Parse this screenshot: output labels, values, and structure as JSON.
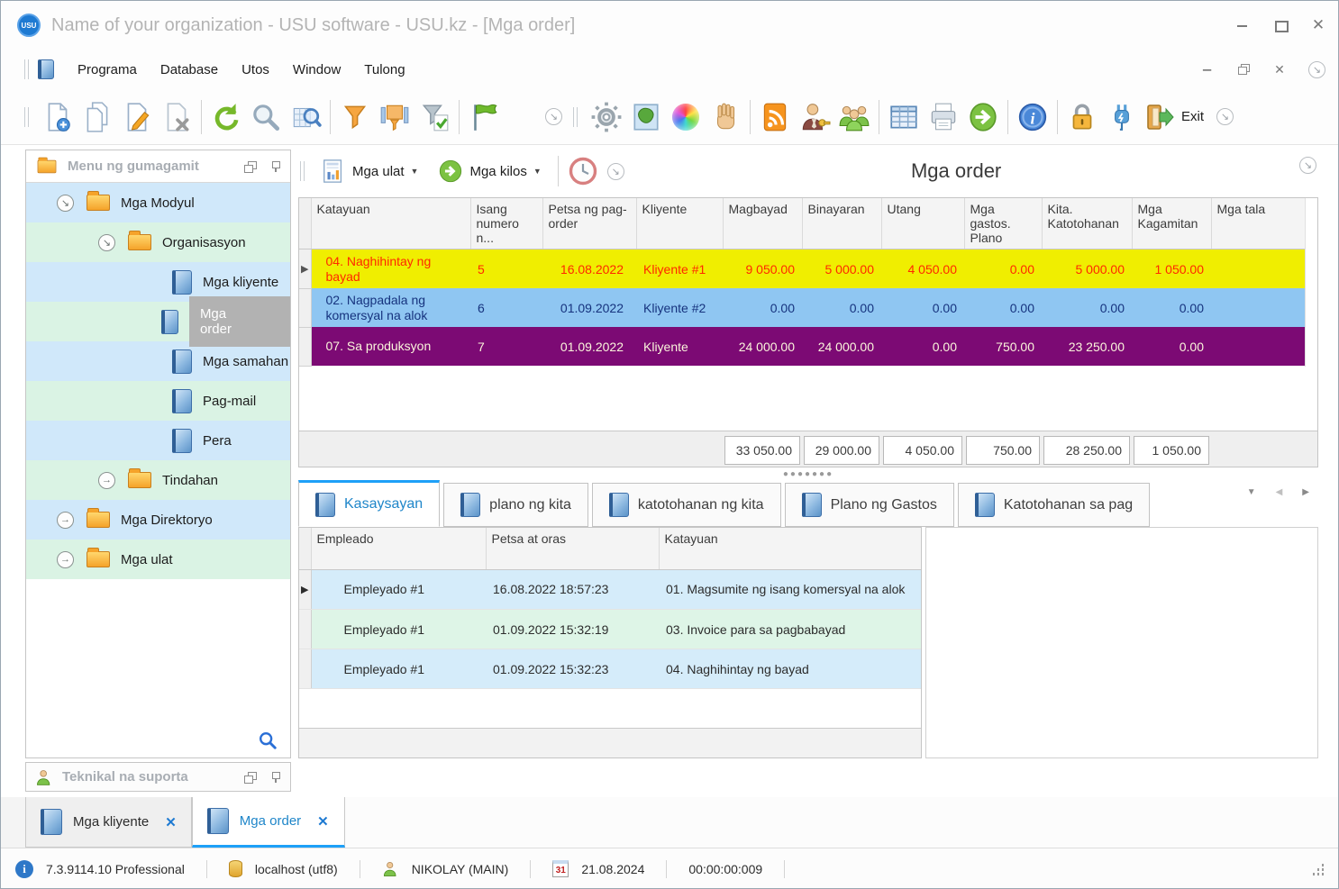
{
  "window": {
    "title": "Name of your organization - USU software - USU.kz - [Mga order]",
    "logo": "USU"
  },
  "menubar": {
    "items": [
      "Programa",
      "Database",
      "Utos",
      "Window",
      "Tulong"
    ]
  },
  "toolbar": {
    "exit_label": "Exit",
    "icons": [
      "new-document",
      "copy-document",
      "edit-document",
      "delete-document",
      "refresh",
      "search",
      "search-grid",
      "filter",
      "filter-settings",
      "filter-apply",
      "flag",
      "collapse",
      "settings",
      "map",
      "colors",
      "pan",
      "rss",
      "user-permissions",
      "user-groups",
      "table",
      "print",
      "go-next",
      "info",
      "lock",
      "plug",
      "exit"
    ]
  },
  "sidebar": {
    "header": "Menu ng gumagamit",
    "support": "Teknikal na suporta",
    "tree": [
      {
        "label": "Mga Modyul"
      },
      {
        "label": "Organisasyon"
      },
      {
        "label": "Mga kliyente"
      },
      {
        "label": "Mga order"
      },
      {
        "label": "Mga samahan"
      },
      {
        "label": "Pag-mail"
      },
      {
        "label": "Pera"
      },
      {
        "label": "Tindahan"
      },
      {
        "label": "Mga Direktoryo"
      },
      {
        "label": "Mga ulat"
      }
    ]
  },
  "main": {
    "reports_button": "Mga ulat",
    "actions_button": "Mga kilos",
    "title": "Mga order"
  },
  "orders": {
    "columns": [
      "Katayuan",
      "Isang numero n...",
      "Petsa ng pag-order",
      "Kliyente",
      "Magbayad",
      "Binayaran",
      "Utang",
      "Mga gastos. Plano",
      "Kita. Katotohanan",
      "Mga Kagamitan",
      "Mga tala"
    ],
    "rows": [
      {
        "status": "04. Naghihintay ng bayad",
        "number": "5",
        "date": "16.08.2022",
        "client": "Kliyente #1",
        "pay": "9 050.00",
        "paid": "5 000.00",
        "debt": "4 050.00",
        "expenses_plan": "0.00",
        "income_fact": "5 000.00",
        "equipment": "1 050.00",
        "notes": ""
      },
      {
        "status": "02. Nagpadala ng komersyal na alok",
        "number": "6",
        "date": "01.09.2022",
        "client": "Kliyente #2",
        "pay": "0.00",
        "paid": "0.00",
        "debt": "0.00",
        "expenses_plan": "0.00",
        "income_fact": "0.00",
        "equipment": "0.00",
        "notes": ""
      },
      {
        "status": "07. Sa produksyon",
        "number": "7",
        "date": "01.09.2022",
        "client": "Kliyente",
        "pay": "24 000.00",
        "paid": "24 000.00",
        "debt": "0.00",
        "expenses_plan": "750.00",
        "income_fact": "23 250.00",
        "equipment": "0.00",
        "notes": ""
      }
    ],
    "totals": {
      "pay": "33 050.00",
      "paid": "29 000.00",
      "debt": "4 050.00",
      "expenses_plan": "750.00",
      "income_fact": "28 250.00",
      "equipment": "1 050.00"
    }
  },
  "detail_tabs": {
    "tabs": [
      "Kasaysayan",
      "plano ng kita",
      "katotohanan ng kita",
      "Plano ng Gastos",
      "Katotohanan sa pag"
    ]
  },
  "history": {
    "columns": [
      "Empleado",
      "Petsa at oras",
      "Katayuan"
    ],
    "rows": [
      {
        "employee": "Empleyado #1",
        "datetime": "16.08.2022 18:57:23",
        "status": "01. Magsumite ng isang komersyal na alok"
      },
      {
        "employee": "Empleyado #1",
        "datetime": "01.09.2022 15:32:19",
        "status": "03. Invoice para sa pagbabayad"
      },
      {
        "employee": "Empleyado #1",
        "datetime": "01.09.2022 15:32:23",
        "status": "04. Naghihintay ng bayad"
      }
    ]
  },
  "window_tabs": [
    {
      "label": "Mga kliyente"
    },
    {
      "label": "Mga order"
    }
  ],
  "statusbar": {
    "version": "7.3.9114.10 Professional",
    "host": "localhost (utf8)",
    "user": "NIKOLAY (MAIN)",
    "date": "21.08.2024",
    "timer": "00:00:00:009"
  },
  "colors": {
    "accent_blue": "#1ea0f8",
    "row_yellow": "#f0ee00",
    "row_yellow_text": "#ff2800",
    "row_blue": "#8fc6f2",
    "row_purple": "#7c0a74",
    "tree_blue": "#d0e8fa",
    "tree_green": "#daf3e4"
  }
}
